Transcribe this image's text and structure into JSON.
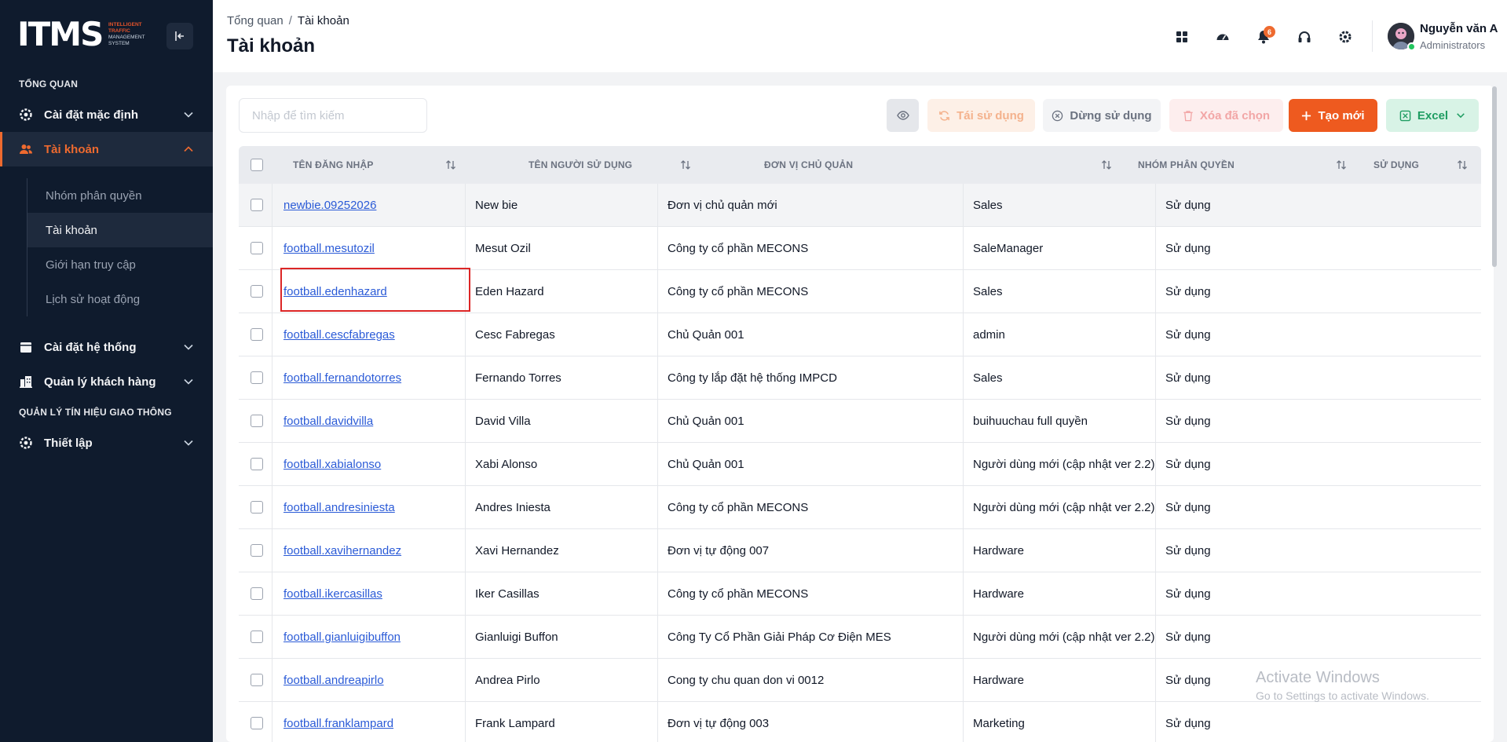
{
  "brand": {
    "logo_text": "ITMS",
    "logo_sub_1": "INTELLIGENT",
    "logo_sub_2": "TRAFFIC",
    "logo_sub_3": "MANAGEMENT",
    "logo_sub_4": "SYSTEM"
  },
  "sidebar": {
    "section_overview": "TỔNG QUAN",
    "section_traffic": "QUẢN LÝ TÍN HIỆU GIAO THÔNG",
    "items": [
      {
        "label": "Cài đặt mặc định",
        "icon": "gear-icon"
      },
      {
        "label": "Tài khoản",
        "icon": "users-icon",
        "active": true
      },
      {
        "label": "Cài đặt hệ thống",
        "icon": "calendar-icon"
      },
      {
        "label": "Quản lý khách hàng",
        "icon": "building-icon"
      },
      {
        "label": "Thiết lập",
        "icon": "gear-icon"
      }
    ],
    "sub_items": [
      {
        "label": "Nhóm phân quyền"
      },
      {
        "label": "Tài khoản",
        "active": true
      },
      {
        "label": "Giới hạn truy cập"
      },
      {
        "label": "Lịch sử hoạt động"
      }
    ]
  },
  "header": {
    "breadcrumb_root": "Tổng quan",
    "breadcrumb_sep": "/",
    "breadcrumb_current": "Tài khoản",
    "title": "Tài khoản",
    "notification_count": "6",
    "user_name": "Nguyễn văn A",
    "user_role": "Administrators"
  },
  "toolbar": {
    "search_placeholder": "Nhập để tìm kiếm",
    "reuse_label": "Tái sử dụng",
    "stop_label": "Dừng sử dụng",
    "delete_label": "Xóa đã chọn",
    "new_label": "Tạo mới",
    "excel_label": "Excel"
  },
  "table": {
    "columns": [
      "TÊN ĐĂNG NHẬP",
      "TÊN NGƯỜI SỬ DỤNG",
      "ĐƠN VỊ CHỦ QUẢN",
      "NHÓM PHÂN QUYỀN",
      "SỬ DỤNG"
    ],
    "rows": [
      {
        "username": "newbie.09252026",
        "fullname": "New bie",
        "unit": "Đơn vị chủ quản mới",
        "group": "Sales",
        "status": "Sử dụng"
      },
      {
        "username": "football.mesutozil",
        "fullname": "Mesut Ozil",
        "unit": "Công ty cổ phần MECONS",
        "group": "SaleManager",
        "status": "Sử dụng"
      },
      {
        "username": "football.edenhazard",
        "fullname": "Eden Hazard",
        "unit": "Công ty cổ phần MECONS",
        "group": "Sales",
        "status": "Sử dụng"
      },
      {
        "username": "football.cescfabregas",
        "fullname": "Cesc Fabregas",
        "unit": "Chủ Quản 001",
        "group": "admin",
        "status": "Sử dụng"
      },
      {
        "username": "football.fernandotorres",
        "fullname": "Fernando Torres",
        "unit": "Công ty lắp đặt hệ thống IMPCD",
        "group": "Sales",
        "status": "Sử dụng"
      },
      {
        "username": "football.davidvilla",
        "fullname": "David Villa",
        "unit": "Chủ Quản 001",
        "group": "buihuuchau full quyền",
        "status": "Sử dụng"
      },
      {
        "username": "football.xabialonso",
        "fullname": "Xabi Alonso",
        "unit": "Chủ Quản 001",
        "group": "Người dùng mới (cập nhật ver 2.2)",
        "status": "Sử dụng"
      },
      {
        "username": "football.andresiniesta",
        "fullname": "Andres Iniesta",
        "unit": "Công ty cổ phần MECONS",
        "group": "Người dùng mới (cập nhật ver 2.2)",
        "status": "Sử dụng"
      },
      {
        "username": "football.xavihernandez",
        "fullname": "Xavi Hernandez",
        "unit": "Đơn vị tự động 007",
        "group": "Hardware",
        "status": "Sử dụng"
      },
      {
        "username": "football.ikercasillas",
        "fullname": "Iker Casillas",
        "unit": "Công ty cổ phần MECONS",
        "group": "Hardware",
        "status": "Sử dụng"
      },
      {
        "username": "football.gianluigibuffon",
        "fullname": "Gianluigi Buffon",
        "unit": "Công Ty Cổ Phần Giải Pháp Cơ Điện MES",
        "group": "Người dùng mới (cập nhật ver 2.2)",
        "status": "Sử dụng"
      },
      {
        "username": "football.andreapirlo",
        "fullname": "Andrea Pirlo",
        "unit": "Cong ty chu quan don vi 0012",
        "group": "Hardware",
        "status": "Sử dụng"
      },
      {
        "username": "football.franklampard",
        "fullname": "Frank Lampard",
        "unit": "Đơn vị tự động 003",
        "group": "Marketing",
        "status": "Sử dụng"
      }
    ]
  },
  "watermark": {
    "line1": "Activate Windows",
    "line2": "Go to Settings to activate Windows."
  },
  "colors": {
    "accent": "#ee5a1f",
    "sidebar_bg": "#0f1b2d",
    "link": "#2b5bd7",
    "highlight": "#dc2626"
  }
}
